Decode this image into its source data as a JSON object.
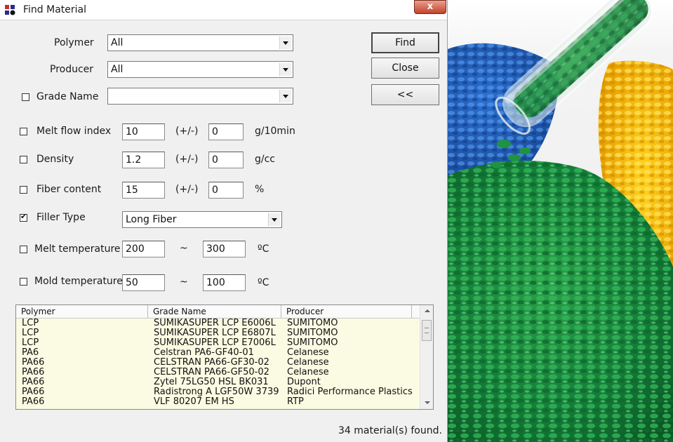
{
  "window": {
    "title": "Find Material",
    "close_glyph": "x"
  },
  "form": {
    "polymer": {
      "label": "Polymer",
      "value": "All"
    },
    "producer": {
      "label": "Producer",
      "value": "All"
    },
    "grade_name": {
      "label": "Grade Name",
      "checked": false,
      "value": ""
    },
    "melt_flow_index": {
      "label": "Melt flow index",
      "checked": false,
      "value": "10",
      "tol_label": "(+/-)",
      "tol": "0",
      "unit": "g/10min"
    },
    "density": {
      "label": "Density",
      "checked": false,
      "value": "1.2",
      "tol_label": "(+/-)",
      "tol": "0",
      "unit": "g/cc"
    },
    "fiber_content": {
      "label": "Fiber content",
      "checked": false,
      "value": "15",
      "tol_label": "(+/-)",
      "tol": "0",
      "unit": "%"
    },
    "filler_type": {
      "label": "Filler Type",
      "checked": true,
      "value": "Long Fiber"
    },
    "melt_temperature": {
      "label": "Melt temperature",
      "checked": false,
      "min": "200",
      "range_sep": "~",
      "max": "300",
      "unit": "ºC"
    },
    "mold_temperature": {
      "label": "Mold temperature",
      "checked": false,
      "min": "50",
      "range_sep": "~",
      "max": "100",
      "unit": "ºC"
    }
  },
  "buttons": {
    "find": "Find",
    "close": "Close",
    "collapse": "<<"
  },
  "results": {
    "columns": [
      "Polymer",
      "Grade Name",
      "Producer"
    ],
    "rows": [
      [
        "LCP",
        "SUMIKASUPER LCP E6006L",
        "SUMITOMO"
      ],
      [
        "LCP",
        "SUMIKASUPER LCP E6807L",
        "SUMITOMO"
      ],
      [
        "LCP",
        "SUMIKASUPER LCP E7006L",
        "SUMITOMO"
      ],
      [
        "PA6",
        "Celstran PA6-GF40-01",
        "Celanese"
      ],
      [
        "PA66",
        "CELSTRAN PA66-GF30-02",
        "Celanese"
      ],
      [
        "PA66",
        "CELSTRAN PA66-GF50-02",
        "Celanese"
      ],
      [
        "PA66",
        "Zytel 75LG50 HSL BK031",
        "Dupont"
      ],
      [
        "PA66",
        "Radistrong A LGF50W 3739",
        "Radici Performance Plastics"
      ],
      [
        "PA66",
        "VLF 80207 EM HS",
        "RTP"
      ]
    ]
  },
  "status": "34 material(s) found."
}
